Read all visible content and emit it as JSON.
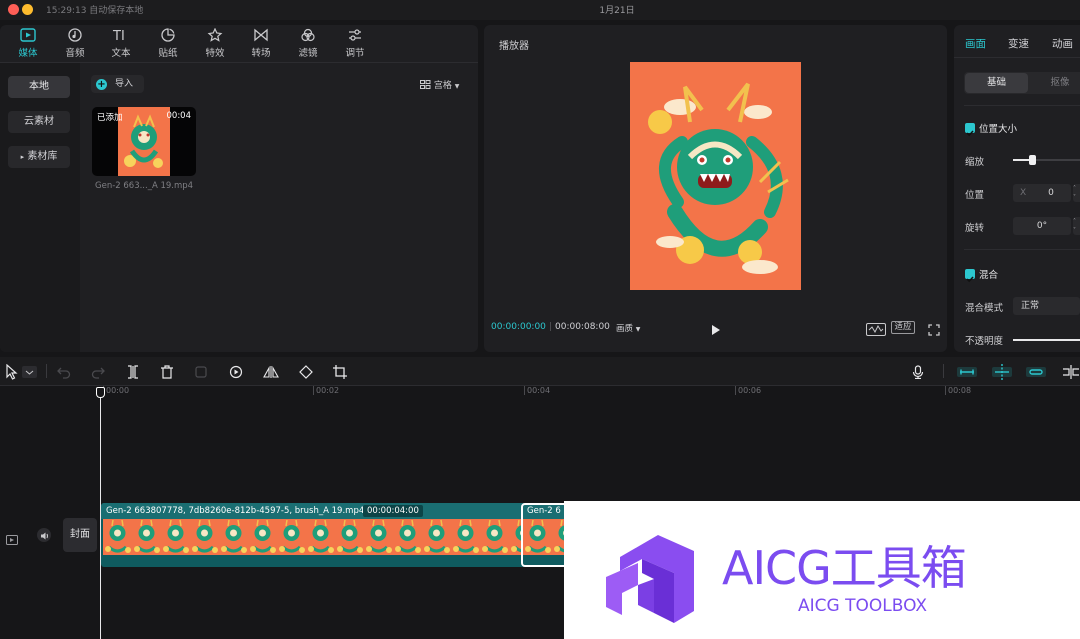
{
  "titlebar": {
    "status": "15:29:13 自动保存本地",
    "date": "1月21日"
  },
  "media_tabs": [
    {
      "label": "媒体",
      "icon": "media-icon",
      "active": true
    },
    {
      "label": "音频",
      "icon": "audio-icon",
      "active": false
    },
    {
      "label": "文本",
      "icon": "text-icon",
      "active": false
    },
    {
      "label": "贴纸",
      "icon": "sticker-icon",
      "active": false
    },
    {
      "label": "特效",
      "icon": "effects-icon",
      "active": false
    },
    {
      "label": "转场",
      "icon": "transition-icon",
      "active": false
    },
    {
      "label": "滤镜",
      "icon": "filter-icon",
      "active": false
    },
    {
      "label": "调节",
      "icon": "adjust-icon",
      "active": false
    }
  ],
  "media_sidebar": {
    "local": "本地",
    "cloud": "云素材",
    "library": "素材库",
    "library_arrow": "▸"
  },
  "media": {
    "import_label": "导入",
    "view_label": "宫格",
    "clip": {
      "added_label": "已添加",
      "duration": "00:04",
      "filename": "Gen-2 663..._A 19.mp4"
    }
  },
  "player": {
    "title": "播放器",
    "time_current": "00:00:00:00",
    "time_total": "00:00:08:00",
    "quality": "画质",
    "fit": "适应"
  },
  "properties": {
    "tabs": [
      "画面",
      "变速",
      "动画"
    ],
    "segments": {
      "basic": "基础",
      "cutout": "抠像"
    },
    "position_size": "位置大小",
    "scale_label": "缩放",
    "scale_level": 0.28,
    "position_label": "位置",
    "pos_x_label": "X",
    "pos_x_value": "0",
    "rotate_label": "旋转",
    "rotate_value": "0°",
    "blend": "混合",
    "blend_mode_label": "混合模式",
    "blend_mode_value": "正常",
    "opacity_label": "不透明度"
  },
  "timeline": {
    "ruler": [
      "00:00",
      "00:02",
      "00:04",
      "00:06",
      "00:08"
    ],
    "clip1_name": "Gen-2 663807778, 7db8260e-812b-4597-5, brush_A 19.mp4",
    "clip1_duration": "00:00:04:00",
    "clip2_name": "Gen-2 6",
    "cover": "封面"
  },
  "watermark": {
    "title": "AICG工具箱",
    "subtitle": "AICG TOOLBOX"
  },
  "colors": {
    "accent": "#2cc7cf",
    "video_bg": "#f37449",
    "dragon": "#1f9e7a",
    "brand": "#7b4cf0"
  }
}
